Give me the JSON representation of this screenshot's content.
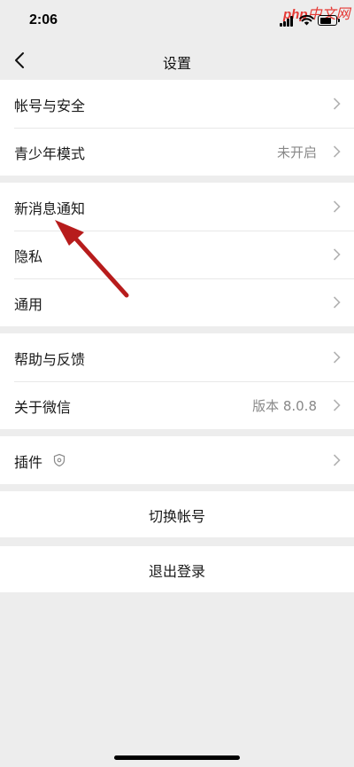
{
  "status_bar": {
    "time": "2:06"
  },
  "watermark": {
    "php": "php",
    "site": "中文网"
  },
  "nav": {
    "title": "设置"
  },
  "groups": [
    {
      "items": [
        {
          "label": "帐号与安全",
          "value": ""
        },
        {
          "label": "青少年模式",
          "value": "未开启"
        }
      ]
    },
    {
      "items": [
        {
          "label": "新消息通知",
          "value": ""
        },
        {
          "label": "隐私",
          "value": ""
        },
        {
          "label": "通用",
          "value": ""
        }
      ]
    },
    {
      "items": [
        {
          "label": "帮助与反馈",
          "value": ""
        },
        {
          "label": "关于微信",
          "value": "版本 8.0.8"
        }
      ]
    },
    {
      "items": [
        {
          "label": "插件",
          "value": ""
        }
      ]
    }
  ],
  "actions": {
    "switch_account": "切换帐号",
    "logout": "退出登录"
  },
  "colors": {
    "background": "#ededed",
    "annotation_arrow": "#b71c1c"
  }
}
